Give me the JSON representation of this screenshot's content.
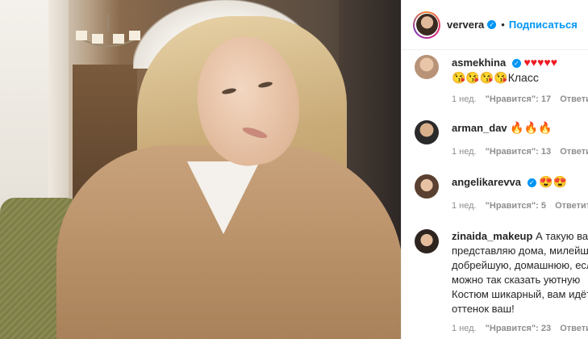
{
  "post": {
    "username": "ververa",
    "separator": "•",
    "follow_label": "Подписаться",
    "verified_icon": "verified-badge-icon"
  },
  "comments": [
    {
      "username": "asmekhina",
      "verified": true,
      "text_line1": "♥♥♥♥♥",
      "text_line2": "😘😘😘😘Класс",
      "age": "1 нед.",
      "likes": "\"Нравится\": 17",
      "reply": "Ответить"
    },
    {
      "username": "arman_dav",
      "verified": false,
      "text_line1": "🔥🔥🔥",
      "age": "1 нед.",
      "likes": "\"Нравится\": 13",
      "reply": "Ответить"
    },
    {
      "username": "angelikarevva",
      "verified": true,
      "text_line1": "😍😍",
      "age": "1 нед.",
      "likes": "\"Нравится\": 5",
      "reply": "Ответить"
    },
    {
      "username": "zinaida_makeup",
      "verified": false,
      "text_first": "А такую вас",
      "text_lines": [
        "представляю дома, милейшая",
        "добрейшую, домашнюю, если",
        "можно так сказать уютную",
        "Костюм шикарный, вам идёт",
        "оттенок ваш!"
      ],
      "age": "1 нед.",
      "likes": "\"Нравится\": 23",
      "reply": "Ответить"
    }
  ],
  "colors": {
    "accent": "#0095f6",
    "meta": "#8e8e8e",
    "text": "#262626"
  }
}
